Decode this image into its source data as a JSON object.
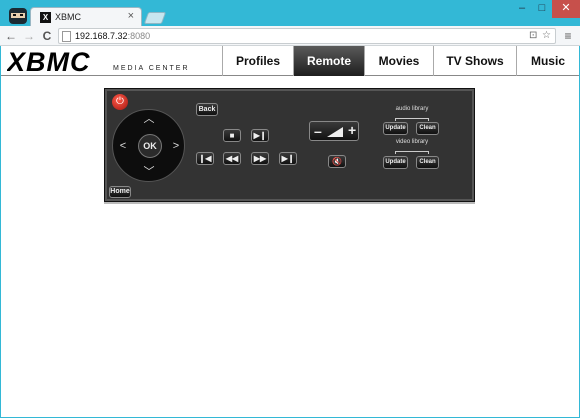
{
  "browser": {
    "tab_title": "XBMC",
    "tab_favicon": "X",
    "tab_close": "×",
    "url_host": "192.168.7.32",
    "url_port": ":8080",
    "back_icon": "←",
    "forward_icon": "→",
    "reload_icon": "C",
    "menu_icon": "≡",
    "star_icon": "☆",
    "minimize": "–",
    "maximize": "□",
    "close": "✕"
  },
  "header": {
    "logo_text": "XBMC",
    "logo_subtitle": "MEDIA CENTER",
    "nav": [
      {
        "label": "Profiles"
      },
      {
        "label": "Remote"
      },
      {
        "label": "Movies"
      },
      {
        "label": "TV Shows"
      },
      {
        "label": "Music"
      }
    ]
  },
  "remote": {
    "power_icon": "power-icon",
    "ok_label": "OK",
    "back_label": "Back",
    "home_label": "Home",
    "volume_minus": "–",
    "volume_plus": "+",
    "audio_library_label": "audio library",
    "video_library_label": "video library",
    "audio_update": "Update",
    "audio_clean": "Clean",
    "video_update": "Update",
    "video_clean": "Clean"
  }
}
